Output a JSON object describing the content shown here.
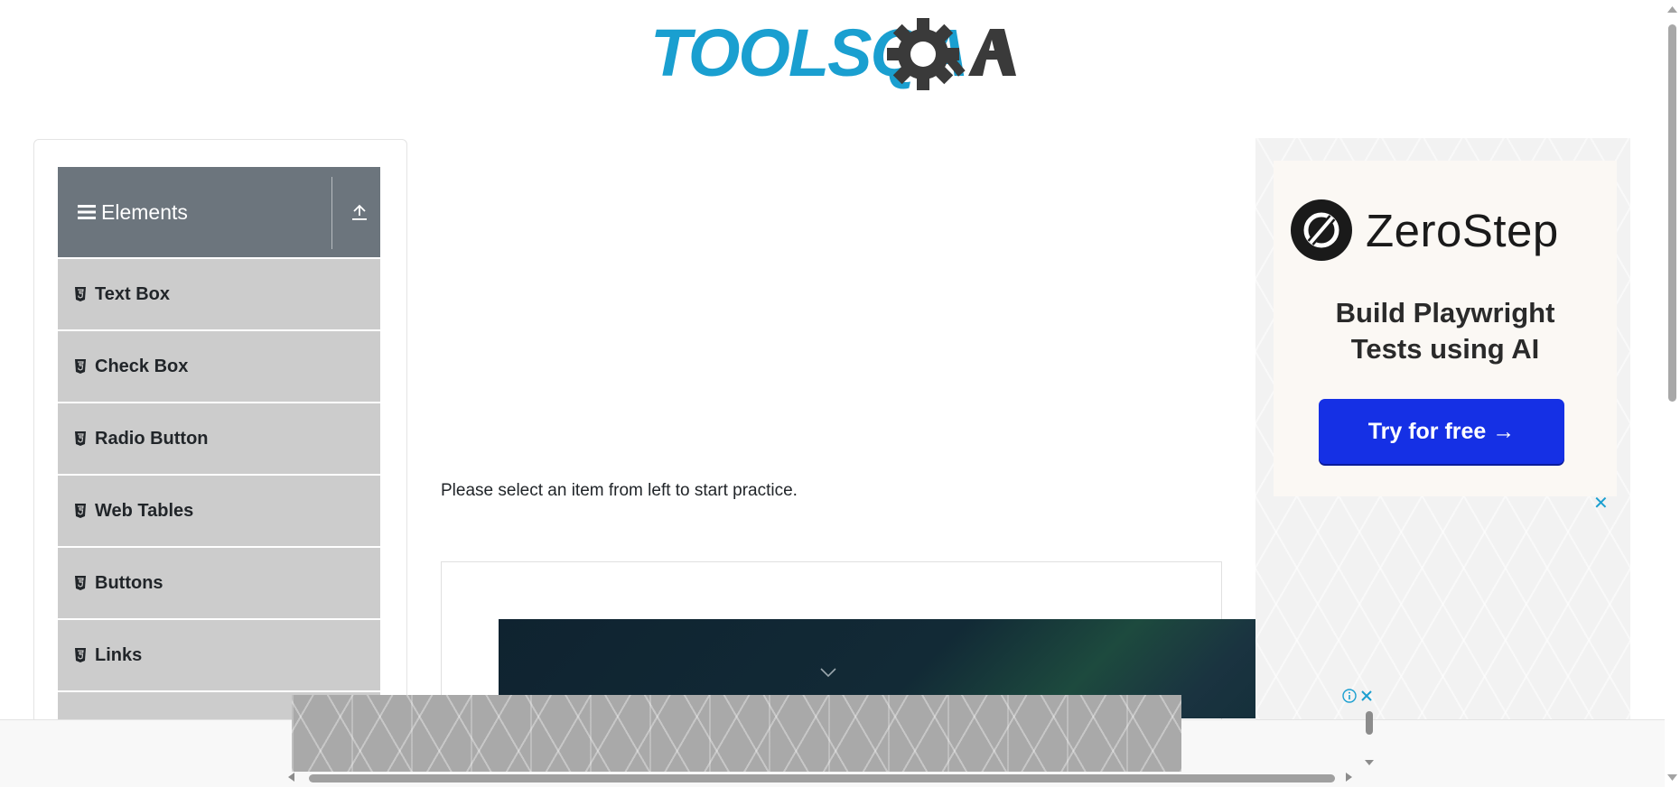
{
  "header": {
    "logo_text": "TOOLSQA"
  },
  "sidebar": {
    "group_title": "Elements",
    "items": [
      {
        "label": "Text Box"
      },
      {
        "label": "Check Box"
      },
      {
        "label": "Radio Button"
      },
      {
        "label": "Web Tables"
      },
      {
        "label": "Buttons"
      },
      {
        "label": "Links"
      }
    ]
  },
  "main": {
    "prompt": "Please select an item from left to start practice."
  },
  "right_ad": {
    "brand": "ZeroStep",
    "tagline_line1": "Build Playwright",
    "tagline_line2": "Tests using AI",
    "cta": "Try for free →",
    "close_symbol": "✕"
  },
  "colors": {
    "logo_blue": "#1a9fd0",
    "logo_dark": "#3a3a3a",
    "sidebar_header": "#6c757d",
    "sidebar_item": "#cccccc",
    "cta_blue": "#1530e5"
  },
  "icons": [
    "menu-bars-icon",
    "collapse-arrow-icon",
    "html5-icon",
    "chevron-down-icon",
    "zerostep-logo-icon",
    "ad-info-icon",
    "close-icon"
  ]
}
